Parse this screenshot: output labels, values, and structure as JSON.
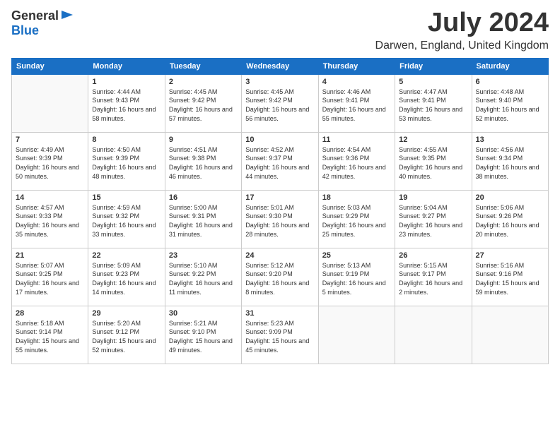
{
  "header": {
    "logo_general": "General",
    "logo_blue": "Blue",
    "month_title": "July 2024",
    "location": "Darwen, England, United Kingdom"
  },
  "weekdays": [
    "Sunday",
    "Monday",
    "Tuesday",
    "Wednesday",
    "Thursday",
    "Friday",
    "Saturday"
  ],
  "weeks": [
    [
      {
        "day": "",
        "sunrise": "",
        "sunset": "",
        "daylight": ""
      },
      {
        "day": "1",
        "sunrise": "Sunrise: 4:44 AM",
        "sunset": "Sunset: 9:43 PM",
        "daylight": "Daylight: 16 hours and 58 minutes."
      },
      {
        "day": "2",
        "sunrise": "Sunrise: 4:45 AM",
        "sunset": "Sunset: 9:42 PM",
        "daylight": "Daylight: 16 hours and 57 minutes."
      },
      {
        "day": "3",
        "sunrise": "Sunrise: 4:45 AM",
        "sunset": "Sunset: 9:42 PM",
        "daylight": "Daylight: 16 hours and 56 minutes."
      },
      {
        "day": "4",
        "sunrise": "Sunrise: 4:46 AM",
        "sunset": "Sunset: 9:41 PM",
        "daylight": "Daylight: 16 hours and 55 minutes."
      },
      {
        "day": "5",
        "sunrise": "Sunrise: 4:47 AM",
        "sunset": "Sunset: 9:41 PM",
        "daylight": "Daylight: 16 hours and 53 minutes."
      },
      {
        "day": "6",
        "sunrise": "Sunrise: 4:48 AM",
        "sunset": "Sunset: 9:40 PM",
        "daylight": "Daylight: 16 hours and 52 minutes."
      }
    ],
    [
      {
        "day": "7",
        "sunrise": "Sunrise: 4:49 AM",
        "sunset": "Sunset: 9:39 PM",
        "daylight": "Daylight: 16 hours and 50 minutes."
      },
      {
        "day": "8",
        "sunrise": "Sunrise: 4:50 AM",
        "sunset": "Sunset: 9:39 PM",
        "daylight": "Daylight: 16 hours and 48 minutes."
      },
      {
        "day": "9",
        "sunrise": "Sunrise: 4:51 AM",
        "sunset": "Sunset: 9:38 PM",
        "daylight": "Daylight: 16 hours and 46 minutes."
      },
      {
        "day": "10",
        "sunrise": "Sunrise: 4:52 AM",
        "sunset": "Sunset: 9:37 PM",
        "daylight": "Daylight: 16 hours and 44 minutes."
      },
      {
        "day": "11",
        "sunrise": "Sunrise: 4:54 AM",
        "sunset": "Sunset: 9:36 PM",
        "daylight": "Daylight: 16 hours and 42 minutes."
      },
      {
        "day": "12",
        "sunrise": "Sunrise: 4:55 AM",
        "sunset": "Sunset: 9:35 PM",
        "daylight": "Daylight: 16 hours and 40 minutes."
      },
      {
        "day": "13",
        "sunrise": "Sunrise: 4:56 AM",
        "sunset": "Sunset: 9:34 PM",
        "daylight": "Daylight: 16 hours and 38 minutes."
      }
    ],
    [
      {
        "day": "14",
        "sunrise": "Sunrise: 4:57 AM",
        "sunset": "Sunset: 9:33 PM",
        "daylight": "Daylight: 16 hours and 35 minutes."
      },
      {
        "day": "15",
        "sunrise": "Sunrise: 4:59 AM",
        "sunset": "Sunset: 9:32 PM",
        "daylight": "Daylight: 16 hours and 33 minutes."
      },
      {
        "day": "16",
        "sunrise": "Sunrise: 5:00 AM",
        "sunset": "Sunset: 9:31 PM",
        "daylight": "Daylight: 16 hours and 31 minutes."
      },
      {
        "day": "17",
        "sunrise": "Sunrise: 5:01 AM",
        "sunset": "Sunset: 9:30 PM",
        "daylight": "Daylight: 16 hours and 28 minutes."
      },
      {
        "day": "18",
        "sunrise": "Sunrise: 5:03 AM",
        "sunset": "Sunset: 9:29 PM",
        "daylight": "Daylight: 16 hours and 25 minutes."
      },
      {
        "day": "19",
        "sunrise": "Sunrise: 5:04 AM",
        "sunset": "Sunset: 9:27 PM",
        "daylight": "Daylight: 16 hours and 23 minutes."
      },
      {
        "day": "20",
        "sunrise": "Sunrise: 5:06 AM",
        "sunset": "Sunset: 9:26 PM",
        "daylight": "Daylight: 16 hours and 20 minutes."
      }
    ],
    [
      {
        "day": "21",
        "sunrise": "Sunrise: 5:07 AM",
        "sunset": "Sunset: 9:25 PM",
        "daylight": "Daylight: 16 hours and 17 minutes."
      },
      {
        "day": "22",
        "sunrise": "Sunrise: 5:09 AM",
        "sunset": "Sunset: 9:23 PM",
        "daylight": "Daylight: 16 hours and 14 minutes."
      },
      {
        "day": "23",
        "sunrise": "Sunrise: 5:10 AM",
        "sunset": "Sunset: 9:22 PM",
        "daylight": "Daylight: 16 hours and 11 minutes."
      },
      {
        "day": "24",
        "sunrise": "Sunrise: 5:12 AM",
        "sunset": "Sunset: 9:20 PM",
        "daylight": "Daylight: 16 hours and 8 minutes."
      },
      {
        "day": "25",
        "sunrise": "Sunrise: 5:13 AM",
        "sunset": "Sunset: 9:19 PM",
        "daylight": "Daylight: 16 hours and 5 minutes."
      },
      {
        "day": "26",
        "sunrise": "Sunrise: 5:15 AM",
        "sunset": "Sunset: 9:17 PM",
        "daylight": "Daylight: 16 hours and 2 minutes."
      },
      {
        "day": "27",
        "sunrise": "Sunrise: 5:16 AM",
        "sunset": "Sunset: 9:16 PM",
        "daylight": "Daylight: 15 hours and 59 minutes."
      }
    ],
    [
      {
        "day": "28",
        "sunrise": "Sunrise: 5:18 AM",
        "sunset": "Sunset: 9:14 PM",
        "daylight": "Daylight: 15 hours and 55 minutes."
      },
      {
        "day": "29",
        "sunrise": "Sunrise: 5:20 AM",
        "sunset": "Sunset: 9:12 PM",
        "daylight": "Daylight: 15 hours and 52 minutes."
      },
      {
        "day": "30",
        "sunrise": "Sunrise: 5:21 AM",
        "sunset": "Sunset: 9:10 PM",
        "daylight": "Daylight: 15 hours and 49 minutes."
      },
      {
        "day": "31",
        "sunrise": "Sunrise: 5:23 AM",
        "sunset": "Sunset: 9:09 PM",
        "daylight": "Daylight: 15 hours and 45 minutes."
      },
      {
        "day": "",
        "sunrise": "",
        "sunset": "",
        "daylight": ""
      },
      {
        "day": "",
        "sunrise": "",
        "sunset": "",
        "daylight": ""
      },
      {
        "day": "",
        "sunrise": "",
        "sunset": "",
        "daylight": ""
      }
    ]
  ]
}
